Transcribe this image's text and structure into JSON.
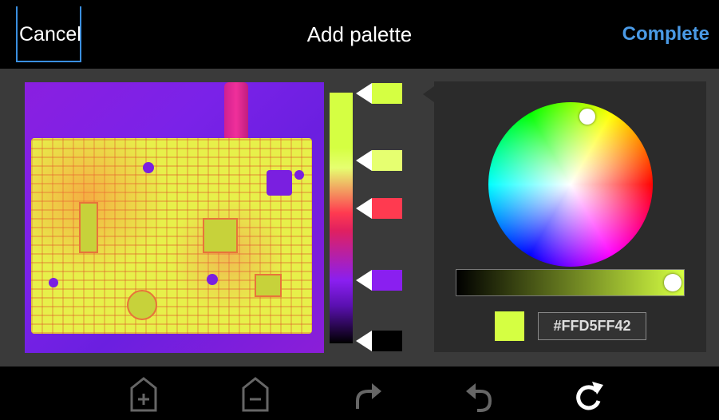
{
  "header": {
    "cancel_label": "Cancel",
    "title": "Add palette",
    "complete_label": "Complete"
  },
  "palette": {
    "stops": [
      {
        "color": "#d5ff42"
      },
      {
        "color": "#e6ff70"
      },
      {
        "color": "#ff3a50"
      },
      {
        "color": "#8a1ff0"
      },
      {
        "color": "#000000"
      }
    ]
  },
  "picker": {
    "selected_color": "#d5ff42",
    "hex_value": "#FFD5FF42"
  },
  "toolbar": {
    "icons": [
      "add-stop-icon",
      "remove-stop-icon",
      "redo-icon",
      "undo-icon",
      "reset-icon"
    ]
  },
  "colors": {
    "accent": "#4a9ae6",
    "header_bg": "#000000",
    "panel_bg": "#2b2b2b"
  }
}
